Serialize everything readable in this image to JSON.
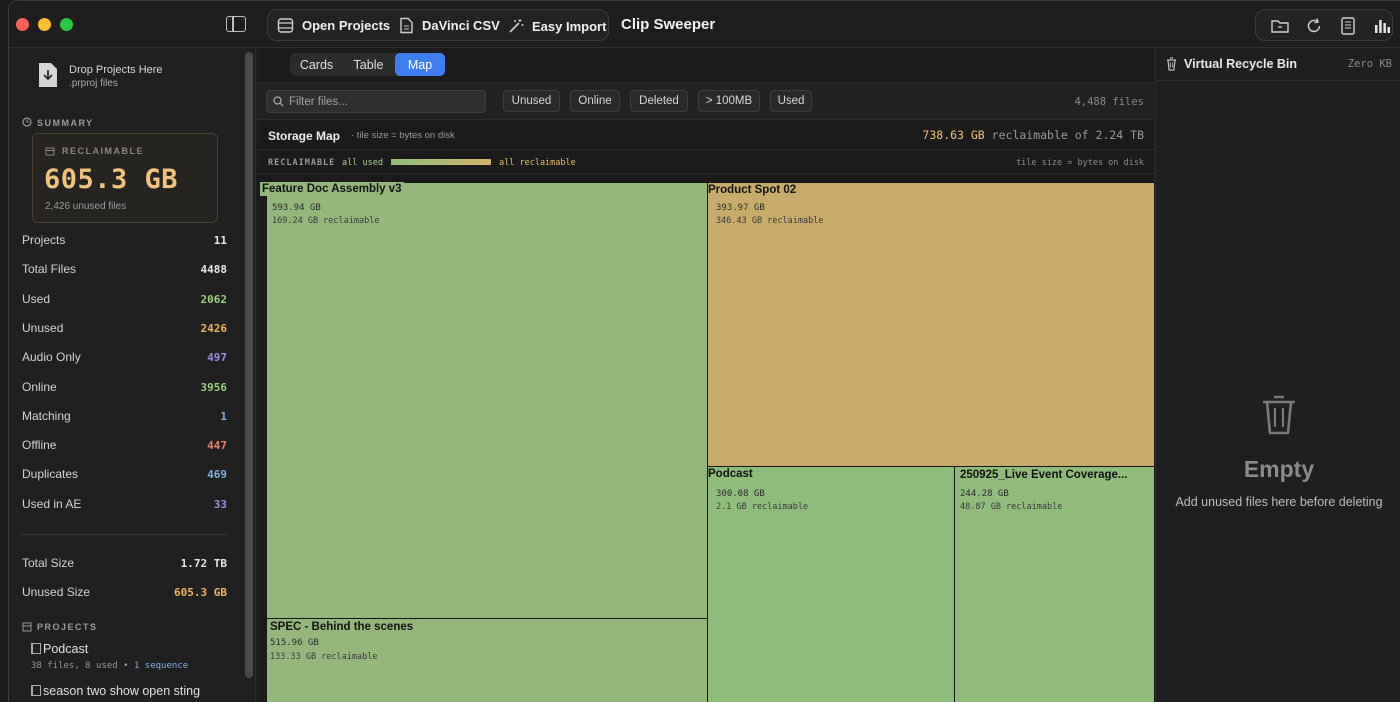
{
  "toolbar": {
    "open_projects": "Open Projects",
    "davinci_csv": "DaVinci CSV",
    "easy_import": "Easy Import",
    "app_title": "Clip Sweeper"
  },
  "sidebar": {
    "drop_title": "Drop Projects Here",
    "drop_sub": ".prproj files",
    "summary_header": "SUMMARY",
    "reclaimable_label": "RECLAIMABLE",
    "reclaimable_value": "605.3 GB",
    "reclaimable_sub": "2,426 unused files",
    "stats": [
      {
        "label": "Projects",
        "value": "11",
        "color": "#e8e8e8"
      },
      {
        "label": "Total Files",
        "value": "4488",
        "color": "#e8e8e8"
      },
      {
        "label": "Used",
        "value": "2062",
        "color": "#9ad07f"
      },
      {
        "label": "Unused",
        "value": "2426",
        "color": "#f0b25c"
      },
      {
        "label": "Audio Only",
        "value": "497",
        "color": "#a08be8"
      },
      {
        "label": "Online",
        "value": "3956",
        "color": "#9ad07f"
      },
      {
        "label": "Matching",
        "value": "1",
        "color": "#7fb2e8"
      },
      {
        "label": "Offline",
        "value": "447",
        "color": "#e8806e"
      },
      {
        "label": "Duplicates",
        "value": "469",
        "color": "#7fb2e8"
      },
      {
        "label": "Used in AE",
        "value": "33",
        "color": "#a08be8"
      }
    ],
    "total_size_label": "Total Size",
    "total_size_value": "1.72 TB",
    "unused_size_label": "Unused Size",
    "unused_size_value": "605.3 GB",
    "projects_header": "PROJECTS",
    "projects": [
      {
        "name": "Podcast",
        "files": "38 files, 8 used",
        "sequence": "1 sequence"
      },
      {
        "name": "season two show open sting"
      }
    ]
  },
  "main": {
    "tabs": [
      "Cards",
      "Table",
      "Map"
    ],
    "active_tab": "Map",
    "filter_placeholder": "Filter files...",
    "filters": [
      "Unused",
      "Online",
      "Deleted",
      "> 100MB",
      "Used"
    ],
    "file_count": "4,488 files",
    "map_title": "Storage Map",
    "map_subtitle": "· tile size = bytes on disk",
    "reclaim_amount": "738.63 GB",
    "reclaim_of": "reclaimable of 2.24 TB",
    "legend_label": "RECLAIMABLE",
    "legend_min": "all used",
    "legend_max": "all reclaimable",
    "legend_right": "tile size = bytes on disk",
    "tiles": [
      {
        "name": "Feature Doc Assembly v3",
        "size": "593.94 GB",
        "reclaim": "169.24 GB reclaimable",
        "color": "#93b77a"
      },
      {
        "name": "Product Spot 02",
        "size": "393.97 GB",
        "reclaim": "346.43 GB reclaimable",
        "color": "#c8ab6a"
      },
      {
        "name": "SPEC - Behind the scenes",
        "size": "515.96 GB",
        "reclaim": "133.33 GB reclaimable",
        "color": "#94b67a"
      },
      {
        "name": "Podcast",
        "size": "300.08 GB",
        "reclaim": "2.1 GB reclaimable",
        "color": "#8ebd7b"
      },
      {
        "name": "250925_Live Event Coverage...",
        "size": "244.28 GB",
        "reclaim": "48.87 GB reclaimable",
        "color": "#8fbb7b"
      }
    ]
  },
  "recycle": {
    "title": "Virtual Recycle Bin",
    "size": "Zero KB",
    "empty_title": "Empty",
    "empty_sub": "Add unused files here before deleting"
  }
}
